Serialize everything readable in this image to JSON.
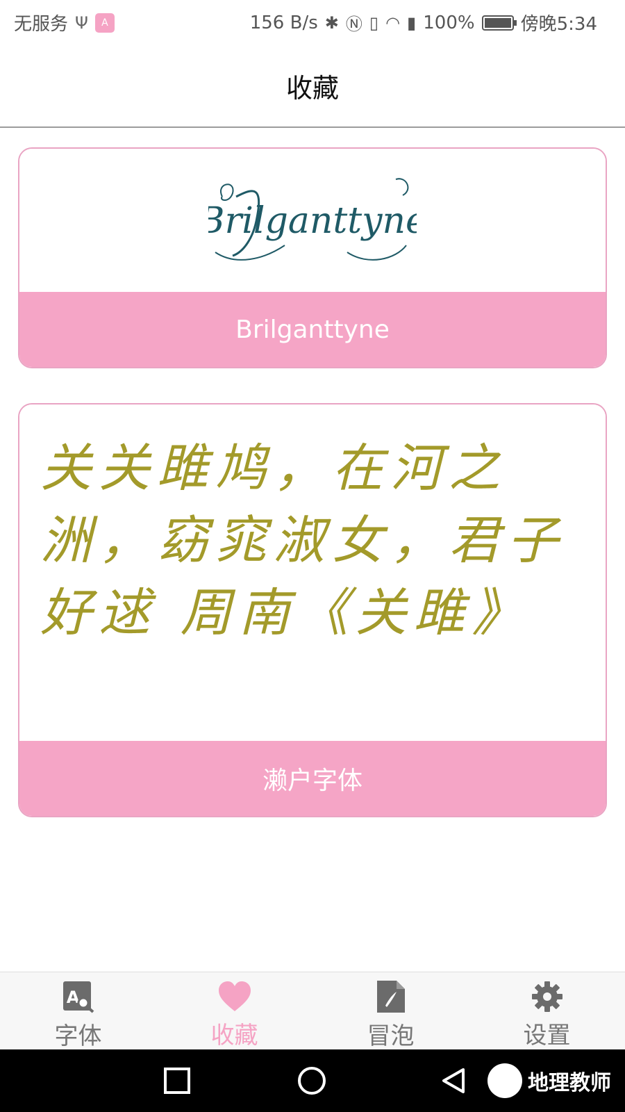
{
  "status_bar": {
    "carrier": "无服务",
    "speed": "156 B/s",
    "battery": "100%",
    "time": "傍晚5:34"
  },
  "header": {
    "title": "收藏"
  },
  "favorites": [
    {
      "preview_text": "Brilganttyne",
      "label": "Brilganttyne"
    },
    {
      "preview_text": "关关雎鸠，在河之洲，窈窕淑女，君子好逑 周南《关雎》",
      "label": "濑户字体"
    }
  ],
  "bottom_nav": [
    {
      "label": "字体",
      "icon": "font-search-icon",
      "active": false
    },
    {
      "label": "收藏",
      "icon": "heart-icon",
      "active": true
    },
    {
      "label": "冒泡",
      "icon": "document-pen-icon",
      "active": false
    },
    {
      "label": "设置",
      "icon": "gear-icon",
      "active": false
    }
  ],
  "watermark": {
    "text": "地理教师"
  },
  "colors": {
    "accent": "#f5a3c4",
    "poem_text": "#a39a2a",
    "logo_ink": "#1f5a66"
  }
}
